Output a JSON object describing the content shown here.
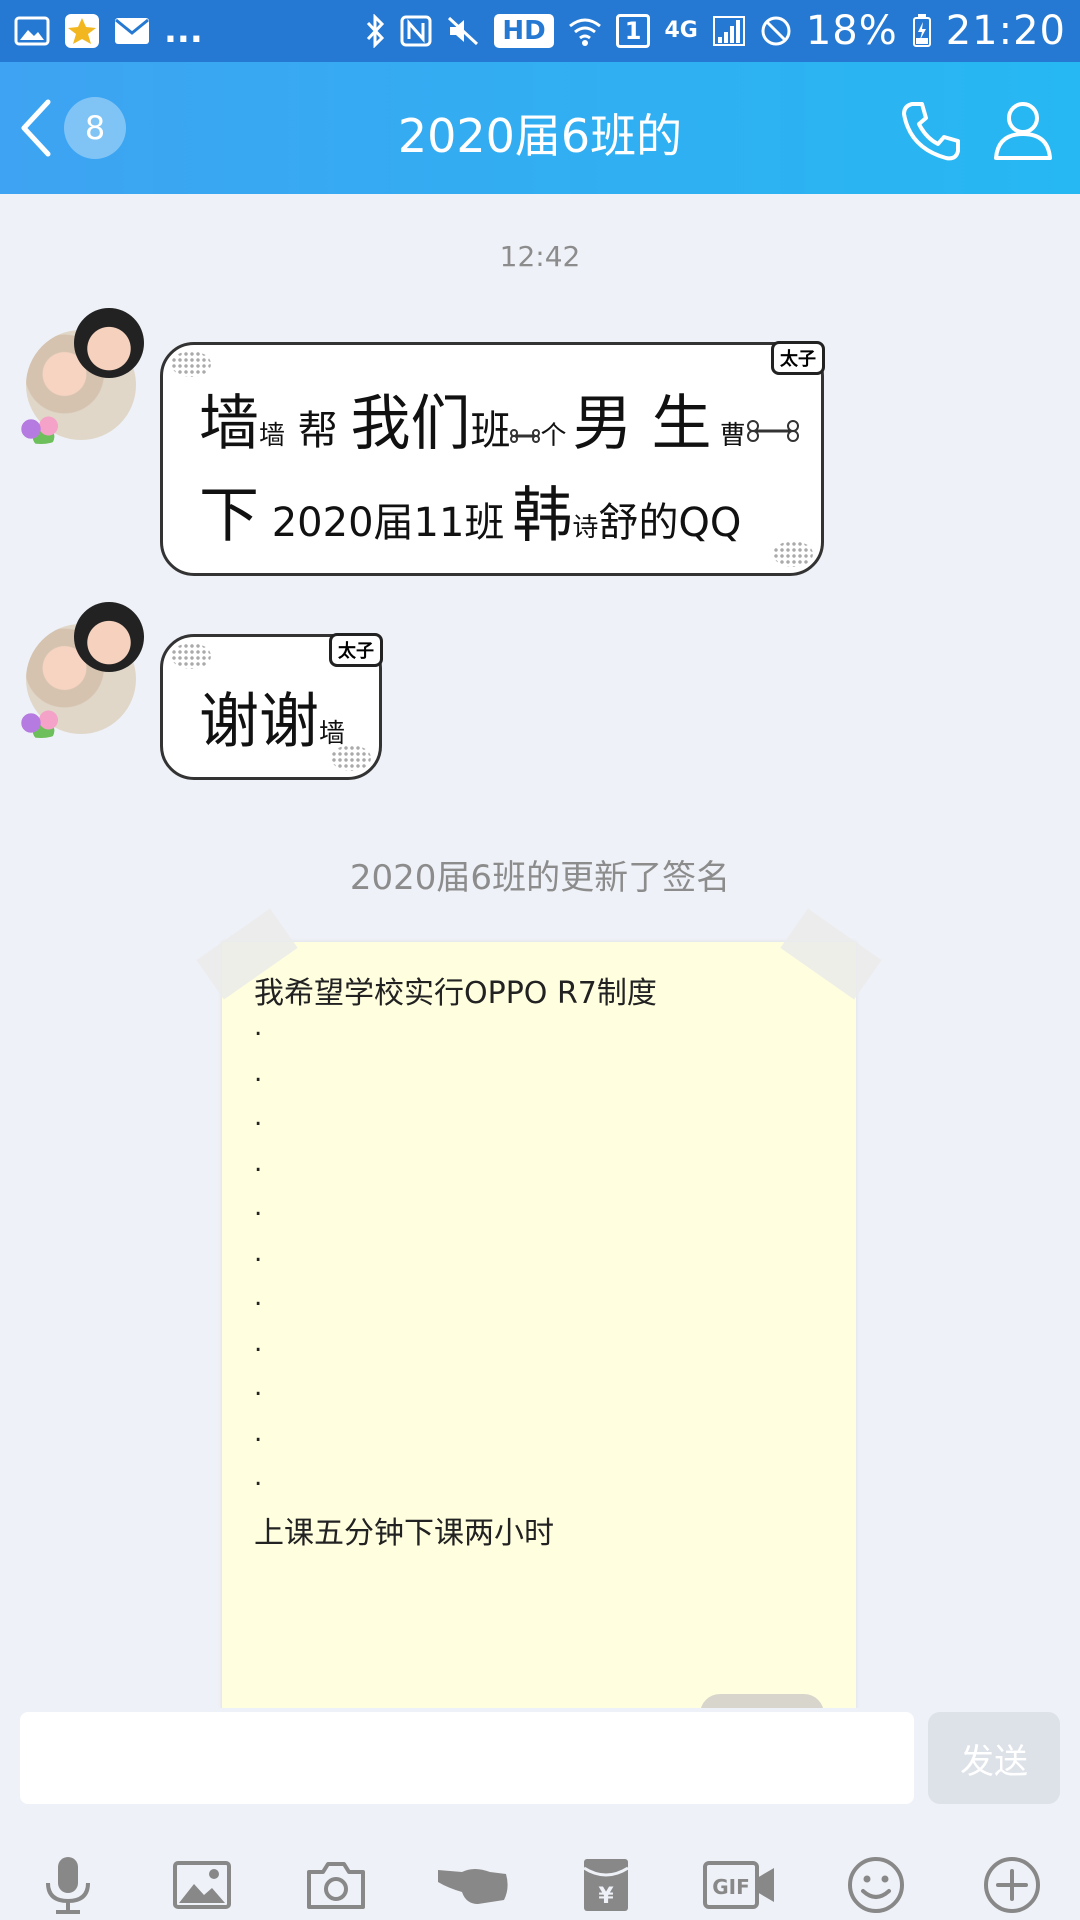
{
  "status_bar": {
    "left_dots": "...",
    "hd": "HD",
    "sim": "1",
    "network": "4G",
    "battery": "18%",
    "time": "21:20"
  },
  "header": {
    "unread_count": "8",
    "title": "2020届6班的"
  },
  "chat": {
    "timestamp": "12:42",
    "messages": [
      {
        "tag": "太子",
        "line1": [
          {
            "t": "墙",
            "size": "big"
          },
          {
            "t": "墙",
            "size": "small"
          },
          {
            "t": " 帮 ",
            "size": "mid"
          },
          {
            "t": "我们",
            "size": "big"
          },
          {
            "t": "班",
            "size": "mid"
          },
          {
            "t": "个",
            "size": "small"
          },
          {
            "t": "男 生",
            "size": "big"
          },
          {
            "t": " 曹",
            "size": "small"
          }
        ],
        "line2": [
          {
            "t": "下",
            "size": "big"
          },
          {
            "t": " 2020届11班",
            "size": "mid"
          },
          {
            "t": "韩",
            "size": "big"
          },
          {
            "t": "诗",
            "size": "small"
          },
          {
            "t": "舒",
            "size": "mid"
          },
          {
            "t": "的QQ",
            "size": "mid"
          }
        ]
      },
      {
        "tag": "太子",
        "line1": [
          {
            "t": "谢谢",
            "size": "big"
          },
          {
            "t": "墙",
            "size": "small"
          }
        ]
      }
    ],
    "system_note": "2020届6班的更新了签名",
    "signature": {
      "first_line": "我希望学校实行OPPO R7制度",
      "dots": [
        ".",
        ".",
        ".",
        ".",
        ".",
        ".",
        ".",
        ".",
        ".",
        ".",
        "."
      ],
      "last_line": "上课五分钟下课两小时"
    }
  },
  "input": {
    "placeholder": "",
    "send_label": "发送"
  },
  "toolbar": {
    "items": [
      "microphone-icon",
      "image-icon",
      "camera-icon",
      "poke-icon",
      "red-packet-icon",
      "gif-icon",
      "emoji-icon",
      "plus-icon"
    ],
    "gif_label": "GIF"
  },
  "colors": {
    "status_bar": "#2579d2",
    "header_start": "#3ea3f2",
    "header_end": "#26b8f2",
    "background": "#eef1f7",
    "note_card": "#fffedf"
  }
}
